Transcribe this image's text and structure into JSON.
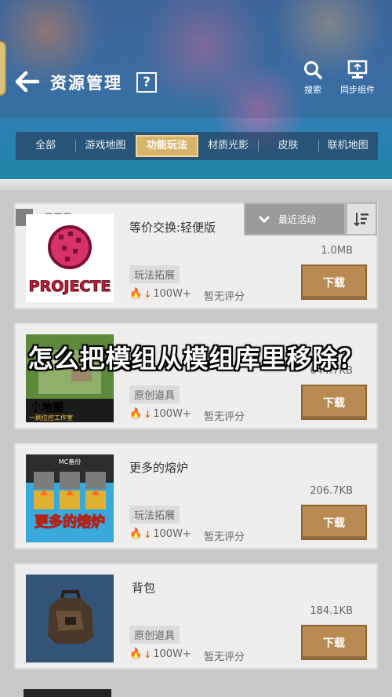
{
  "header": {
    "title": "资源管理",
    "help_label": "?",
    "actions": [
      {
        "label": "搜索",
        "icon": "search-icon"
      },
      {
        "label": "同步组件",
        "icon": "sync-icon"
      }
    ]
  },
  "tabs": [
    {
      "label": "全部",
      "active": false
    },
    {
      "label": "游戏地图",
      "active": false
    },
    {
      "label": "功能玩法",
      "active": true
    },
    {
      "label": "材质光影",
      "active": false
    },
    {
      "label": "皮肤",
      "active": false
    },
    {
      "label": "联机地图",
      "active": false
    }
  ],
  "sort": {
    "label": "最近活动"
  },
  "downloaded_label": "已下载",
  "overlay_caption": "怎么把模组从模组库里移除？",
  "items": [
    {
      "name": "等价交换:轻便版",
      "size": "1.0MB",
      "tag": "玩法拓展",
      "downloads": "100W+",
      "rating": "暂无评分",
      "button": "下载",
      "thumb_text": "PROJECTE"
    },
    {
      "name": "",
      "size": "644.7KB",
      "tag": "原创道具",
      "downloads": "100W+",
      "rating": "暂无评分",
      "button": "下载",
      "thumb_text": "小地图",
      "thumb_subtext": "一刷位控工作室"
    },
    {
      "name": "更多的熔炉",
      "size": "206.7KB",
      "tag": "玩法拓展",
      "downloads": "100W+",
      "rating": "暂无评分",
      "button": "下载",
      "thumb_text": "更多的熔炉",
      "thumb_badge": "MC备份"
    },
    {
      "name": "背包",
      "size": "184.1KB",
      "tag": "原创道具",
      "downloads": "100W+",
      "rating": "暂无评分",
      "button": "下载"
    }
  ],
  "colors": {
    "accent_tab": "#d8b46a",
    "download_button": "#b98a52",
    "card_bg": "#eeeeee",
    "fire": "#e06a2a"
  }
}
